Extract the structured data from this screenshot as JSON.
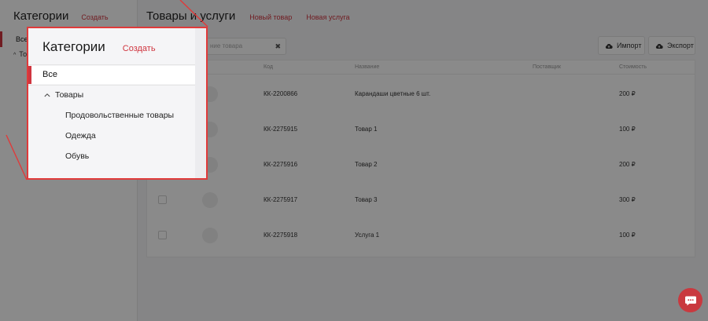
{
  "sidebar": {
    "title": "Категории",
    "create_label": "Создать",
    "items": [
      {
        "label": "Все",
        "active": true
      },
      {
        "label": "Товары",
        "expanded": true,
        "children": [
          "Продовольственные товары",
          "Одежда",
          "Обувь"
        ]
      }
    ]
  },
  "main": {
    "title": "Товары и услуги",
    "new_product": "Новый товар",
    "new_service": "Новая услуга",
    "search_placeholder": "ние товара",
    "import_label": "Импорт",
    "export_label": "Экспорт"
  },
  "table": {
    "columns": [
      "Код",
      "Название",
      "Поставщик",
      "Стоимость"
    ],
    "rows": [
      {
        "code": "КК-2200866",
        "name": "Карандаши цветные 6 шт.",
        "supplier": "",
        "price": "200 ₽"
      },
      {
        "code": "КК-2275915",
        "name": "Товар 1",
        "supplier": "",
        "price": "100 ₽"
      },
      {
        "code": "КК-2275916",
        "name": "Товар 2",
        "supplier": "",
        "price": "200 ₽"
      },
      {
        "code": "КК-2275917",
        "name": "Товар 3",
        "supplier": "",
        "price": "300 ₽"
      },
      {
        "code": "КК-2275918",
        "name": "Услуга 1",
        "supplier": "",
        "price": "100 ₽"
      }
    ]
  },
  "zoom_panel": {
    "title": "Категории",
    "create_label": "Создать",
    "all_label": "Все",
    "goods_label": "Товары",
    "children": [
      "Продовольственные товары",
      "Одежда",
      "Обувь"
    ]
  },
  "icons": {
    "import": "cloud-upload-icon",
    "export": "cloud-upload-icon",
    "chat": "chat-icon",
    "clear": "close-icon",
    "expand": "chevron-up-icon"
  },
  "colors": {
    "accent": "#d0353f",
    "callout_border": "#e03a3a",
    "chat_bubble": "#c9393f"
  }
}
